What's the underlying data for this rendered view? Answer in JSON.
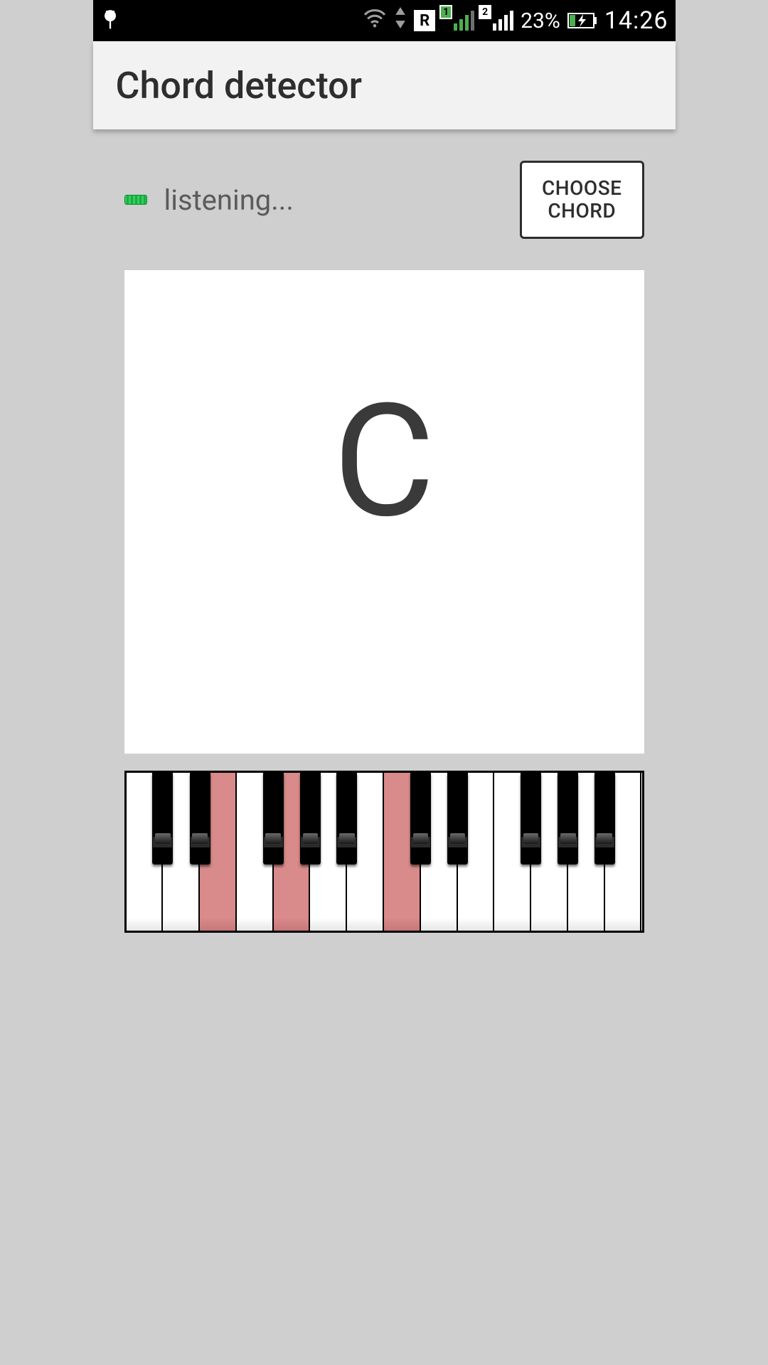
{
  "status_bar": {
    "sim1_label": "1",
    "sim2_label": "2",
    "r_label": "R",
    "battery_pct": "23%",
    "time": "14:26"
  },
  "app_bar": {
    "title": "Chord detector"
  },
  "top_row": {
    "listening_text": "listening...",
    "choose_chord_label": "CHOOSE\nCHORD"
  },
  "chord": {
    "name": "C"
  },
  "piano": {
    "white_count": 14,
    "active_white_indices": [
      2,
      4,
      7
    ],
    "black_positions_pct": [
      5.1,
      12.3,
      26.5,
      33.7,
      40.8,
      55.1,
      62.3,
      76.5,
      83.7,
      90.8
    ]
  },
  "colors": {
    "active_key": "#d98a8a"
  }
}
